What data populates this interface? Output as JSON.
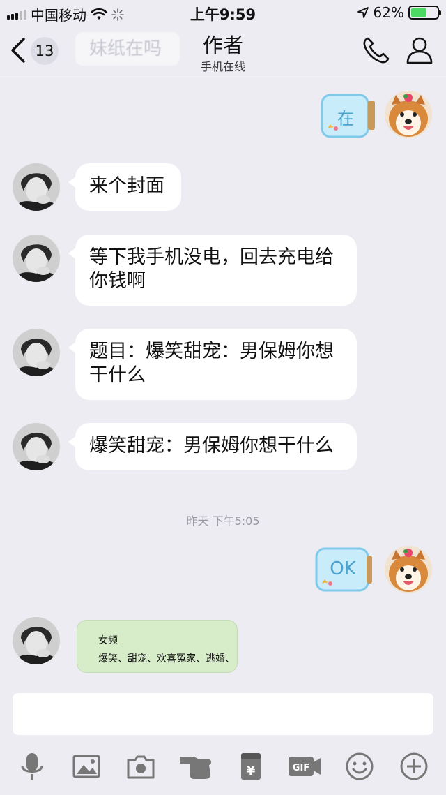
{
  "status_bar": {
    "carrier": "中国移动",
    "time": "上午9:59",
    "battery_percent": "62%",
    "battery_level": 0.62
  },
  "nav": {
    "unread_count": "13",
    "preview_text": "妹纸在吗",
    "title": "作者",
    "subtitle": "手机在线"
  },
  "messages": [
    {
      "side": "out",
      "type": "sticker",
      "label": "在"
    },
    {
      "side": "in",
      "type": "text",
      "text": "来个封面"
    },
    {
      "side": "in",
      "type": "text",
      "text": "等下我手机没电，回去充电给你钱啊"
    },
    {
      "side": "in",
      "type": "text",
      "text": "题目：爆笑甜宠：男保姆你想干什么"
    },
    {
      "side": "in",
      "type": "text",
      "text": "爆笑甜宠：男保姆你想干什么"
    },
    {
      "side": "system",
      "type": "timestamp",
      "text": "昨天 下午5:05"
    },
    {
      "side": "out",
      "type": "sticker",
      "label": "OK"
    },
    {
      "side": "in",
      "type": "image-card",
      "line1": "女频",
      "line2": "爆笑、甜宠、欢喜冤家、逃婚、"
    }
  ],
  "toolbar": {
    "items": [
      "microphone-icon",
      "image-icon",
      "camera-icon",
      "poke-icon",
      "red-packet-icon",
      "gif-icon",
      "emoji-icon",
      "plus-icon"
    ],
    "gif_label": "GIF",
    "red_packet_symbol": "¥"
  },
  "colors": {
    "background": "#ececf2",
    "bubble_in": "#ffffff",
    "card_green": "#d7ecc8",
    "battery_green": "#4cd964",
    "jar_blue": "#4aa3cf"
  }
}
